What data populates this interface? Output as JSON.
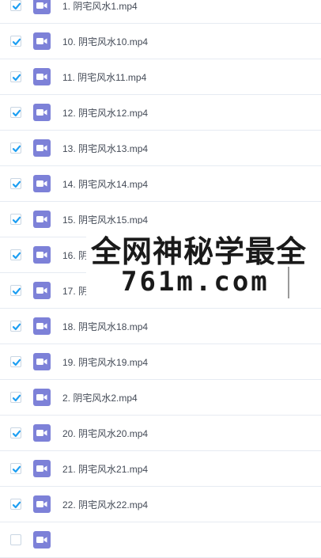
{
  "files": [
    {
      "name": "1. 阴宅风水1.mp4",
      "checked": true
    },
    {
      "name": "10. 阴宅风水10.mp4",
      "checked": true
    },
    {
      "name": "11. 阴宅风水11.mp4",
      "checked": true
    },
    {
      "name": "12. 阴宅风水12.mp4",
      "checked": true
    },
    {
      "name": "13. 阴宅风水13.mp4",
      "checked": true
    },
    {
      "name": "14. 阴宅风水14.mp4",
      "checked": true
    },
    {
      "name": "15. 阴宅风水15.mp4",
      "checked": true
    },
    {
      "name": "16. 阴宅风水16.mp4",
      "checked": true
    },
    {
      "name": "17. 阴宅风水17.mp4",
      "checked": true
    },
    {
      "name": "18. 阴宅风水18.mp4",
      "checked": true
    },
    {
      "name": "19. 阴宅风水19.mp4",
      "checked": true
    },
    {
      "name": "2. 阴宅风水2.mp4",
      "checked": true
    },
    {
      "name": "20. 阴宅风水20.mp4",
      "checked": true
    },
    {
      "name": "21. 阴宅风水21.mp4",
      "checked": true
    },
    {
      "name": "22. 阴宅风水22.mp4",
      "checked": true
    },
    {
      "name": "",
      "checked": false
    }
  ],
  "watermark": {
    "line1": "全网神秘学最全",
    "line2": "761m.com"
  },
  "colors": {
    "check": "#1e9ff2",
    "file_icon": "#7d81d8",
    "divider": "#e6ebf2",
    "text": "#444b57"
  },
  "icons": {
    "checkbox": "checkbox-checked-icon",
    "file": "video-file-icon"
  }
}
